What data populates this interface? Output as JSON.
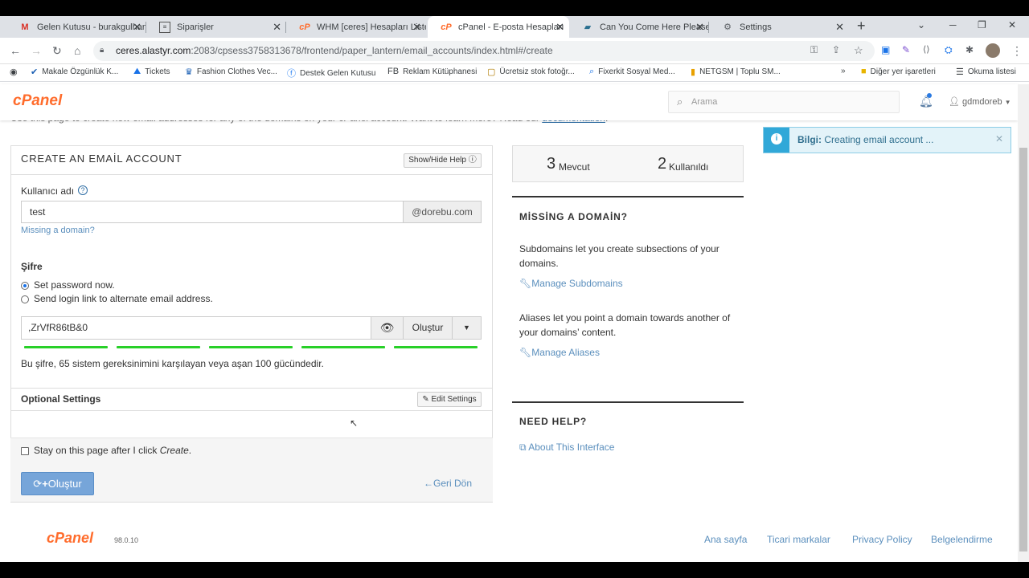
{
  "browser": {
    "tabs": [
      {
        "title": "Gelen Kutusu - burakgulhan",
        "icon": "gmail-icon",
        "active": false
      },
      {
        "title": "Siparişler",
        "icon": "orders-icon",
        "active": false
      },
      {
        "title": "WHM [ceres] Hesapları Liste",
        "icon": "cpanel-icon",
        "active": false
      },
      {
        "title": "cPanel - E-posta Hesapları",
        "icon": "cpanel-icon",
        "active": true
      },
      {
        "title": "Can You Come Here Please",
        "icon": "chat-icon",
        "active": false
      },
      {
        "title": "Settings",
        "icon": "gear-icon",
        "active": false
      }
    ],
    "url_host": "ceres.alastyr.com",
    "url_path": ":2083/cpsess3758313678/frontend/paper_lantern/email_accounts/index.html#/create",
    "bookmarks": [
      "Makale Özgünlük K...",
      "Tickets",
      "Fashion Clothes Vec...",
      "Destek Gelen Kutusu",
      "Reklam Kütüphanesi",
      "Ücretsiz stok fotoğr...",
      "Fixerkit Sosyal Med...",
      "NETGSM | Toplu SM..."
    ],
    "bookmark_fb_prefix": "FB",
    "other_bookmarks": "Diğer yer işaretleri",
    "reading_list": "Okuma listesi",
    "more_bookmarks": "»"
  },
  "header": {
    "logo": "cPanel",
    "search_placeholder": "Arama",
    "username": "gdmdoreb",
    "accent": "#ff6c2c"
  },
  "intro": {
    "text": "Use this page to create new email addresses for any of the domains on your cPanel account. Want to learn more? Read our ",
    "link": "documentation",
    "tail": "."
  },
  "form": {
    "title": "CREATE AN EMAİL ACCOUNT",
    "show_help": "Show/Hide Help",
    "username_label": "Kullanıcı adı",
    "username_value": "test",
    "domain_addon": "@dorebu.com",
    "missing_domain": "Missing a domain?",
    "password_label": "Şifre",
    "radio_set": "Set password now.",
    "radio_send": "Send login link to alternate email address.",
    "password_value": ",ZrVfR86tB&0",
    "generate": "Oluştur",
    "strength_text": "Bu şifre, 65 sistem gereksinimini karşılayan veya aşan 100 gücündedir.",
    "strength_percent": 100,
    "optional_settings": "Optional Settings",
    "edit_settings": "Edit Settings",
    "stay_prefix": "Stay on this page after I click ",
    "stay_em": "Create",
    "stay_suffix": ".",
    "create_button": "Oluştur",
    "back": "Geri Dön"
  },
  "stats": {
    "available_num": "3",
    "available_label": "Mevcut",
    "used_num": "2",
    "used_label": "Kullanıldı"
  },
  "sidebar": {
    "missing_title": "MİSSİNG A DOMAİN?",
    "subdomains_text": "Subdomains let you create subsections of your domains.",
    "manage_subdomains": "Manage Subdomains",
    "aliases_text": "Aliases let you point a domain towards another of your domains’ content.",
    "manage_aliases": "Manage Aliases",
    "help_title": "NEED HELP?",
    "about": "About This Interface"
  },
  "toast": {
    "label": "Bilgi:",
    "message": "Creating email account ..."
  },
  "footer": {
    "logo": "cPanel",
    "version": "98.0.10",
    "links": [
      "Ana sayfa",
      "Ticari markalar",
      "Privacy Policy",
      "Belgelendirme"
    ]
  }
}
